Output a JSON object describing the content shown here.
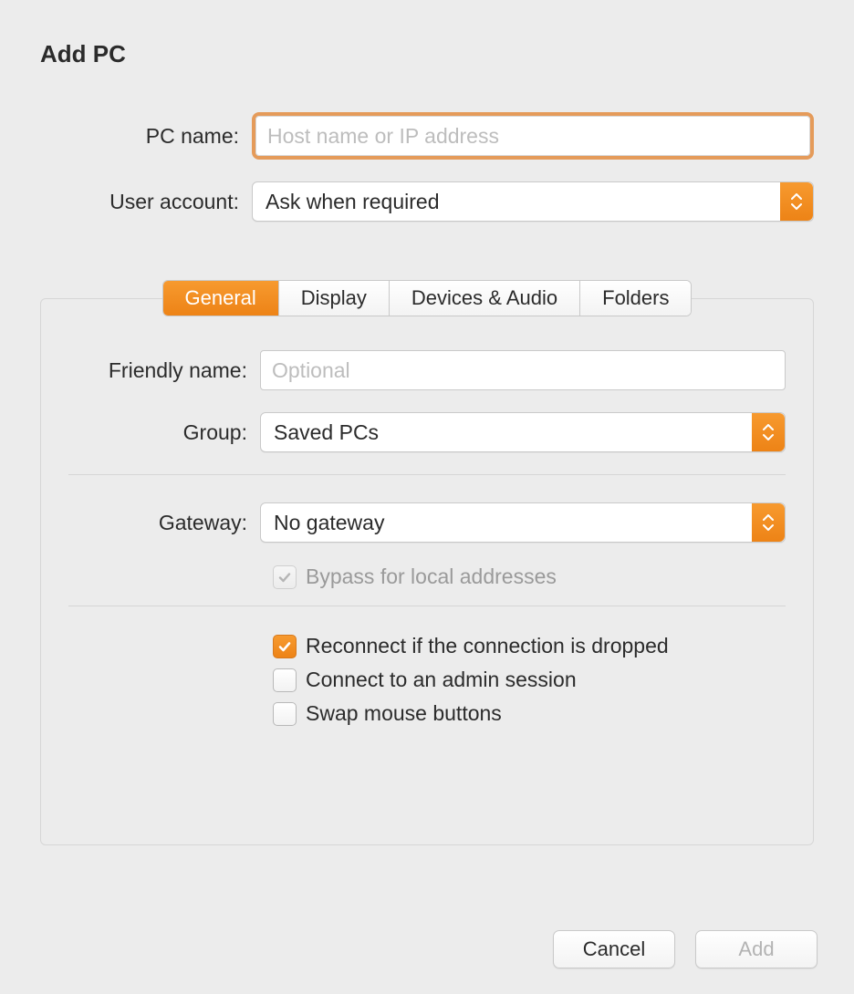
{
  "title": "Add PC",
  "top": {
    "pc_name_label": "PC name:",
    "pc_name_placeholder": "Host name or IP address",
    "pc_name_value": "",
    "user_account_label": "User account:",
    "user_account_value": "Ask when required"
  },
  "tabs": {
    "general": "General",
    "display": "Display",
    "devices": "Devices & Audio",
    "folders": "Folders"
  },
  "general": {
    "friendly_name_label": "Friendly name:",
    "friendly_name_placeholder": "Optional",
    "friendly_name_value": "",
    "group_label": "Group:",
    "group_value": "Saved PCs",
    "gateway_label": "Gateway:",
    "gateway_value": "No gateway",
    "bypass_label": "Bypass for local addresses",
    "bypass_checked": true,
    "bypass_enabled": false,
    "reconnect_label": "Reconnect if the connection is dropped",
    "reconnect_checked": true,
    "admin_label": "Connect to an admin session",
    "admin_checked": false,
    "swap_label": "Swap mouse buttons",
    "swap_checked": false
  },
  "buttons": {
    "cancel": "Cancel",
    "add": "Add"
  },
  "colors": {
    "accent": "#ef8a1f"
  }
}
